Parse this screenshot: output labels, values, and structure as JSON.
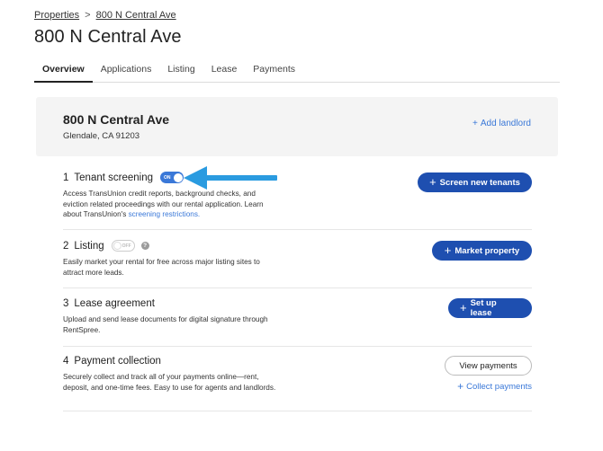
{
  "breadcrumb": {
    "parent": "Properties",
    "separator": ">",
    "current": "800 N Central Ave"
  },
  "page_title": "800 N Central Ave",
  "tabs": [
    {
      "label": "Overview",
      "active": true
    },
    {
      "label": "Applications",
      "active": false
    },
    {
      "label": "Listing",
      "active": false
    },
    {
      "label": "Lease",
      "active": false
    },
    {
      "label": "Payments",
      "active": false
    }
  ],
  "property_card": {
    "title": "800 N Central Ave",
    "address": "Glendale, CA 91203",
    "add_landlord": "Add landlord"
  },
  "sections": {
    "screening": {
      "number": "1",
      "name": "Tenant screening",
      "toggle_label": "ON",
      "desc_1": "Access TransUnion credit reports, background checks, and eviction related proceedings with our rental application. Learn about TransUnion's ",
      "desc_link": "screening restrictions.",
      "button": "Screen new tenants"
    },
    "listing": {
      "number": "2",
      "name": "Listing",
      "toggle_label": "OFF",
      "help": "?",
      "desc": "Easily market your rental for free across major listing sites to attract more leads.",
      "button": "Market property"
    },
    "lease": {
      "number": "3",
      "name": "Lease agreement",
      "desc": "Upload and send lease documents for digital signature through RentSpree.",
      "button": "Set up lease"
    },
    "payment": {
      "number": "4",
      "name": "Payment collection",
      "desc": "Securely collect and track all of your payments online—rent, deposit, and one-time fees. Easy to use for agents and landlords.",
      "button": "View payments",
      "link": "Collect payments"
    }
  },
  "colors": {
    "primary_button": "#1e4fb0",
    "link": "#3a78d8",
    "arrow": "#2a9be0"
  }
}
